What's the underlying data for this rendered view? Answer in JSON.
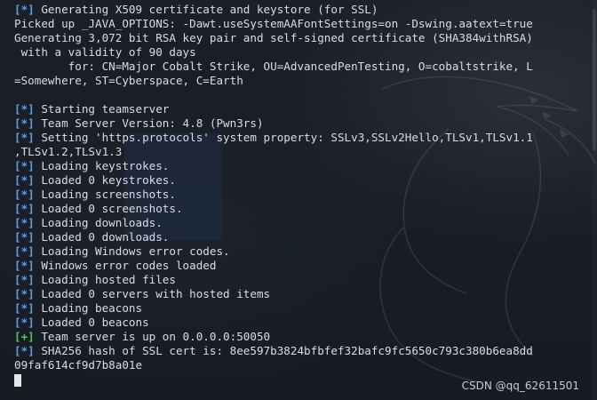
{
  "terminal": {
    "lines": [
      {
        "tag": "[*]",
        "tag_type": "info",
        "text": " Generating X509 certificate and keystore (for SSL)"
      },
      {
        "tag": "",
        "tag_type": "",
        "text": "Picked up _JAVA_OPTIONS: -Dawt.useSystemAAFontSettings=on -Dswing.aatext=true"
      },
      {
        "tag": "",
        "tag_type": "",
        "text": "Generating 3,072 bit RSA key pair and self-signed certificate (SHA384withRSA)"
      },
      {
        "tag": "",
        "tag_type": "",
        "text": " with a validity of 90 days"
      },
      {
        "tag": "",
        "tag_type": "",
        "text": "        for: CN=Major Cobalt Strike, OU=AdvancedPenTesting, O=cobaltstrike, L"
      },
      {
        "tag": "",
        "tag_type": "",
        "text": "=Somewhere, ST=Cyberspace, C=Earth"
      },
      {
        "tag": "",
        "tag_type": "",
        "text": ""
      },
      {
        "tag": "[*]",
        "tag_type": "info",
        "text": " Starting teamserver"
      },
      {
        "tag": "[*]",
        "tag_type": "info",
        "text": " Team Server Version: 4.8 (Pwn3rs)"
      },
      {
        "tag": "[*]",
        "tag_type": "info",
        "text": " Setting 'https.protocols' system property: SSLv3,SSLv2Hello,TLSv1,TLSv1.1"
      },
      {
        "tag": "",
        "tag_type": "",
        "text": ",TLSv1.2,TLSv1.3"
      },
      {
        "tag": "[*]",
        "tag_type": "info",
        "text": " Loading keystrokes."
      },
      {
        "tag": "[*]",
        "tag_type": "info",
        "text": " Loaded 0 keystrokes."
      },
      {
        "tag": "[*]",
        "tag_type": "info",
        "text": " Loading screenshots."
      },
      {
        "tag": "[*]",
        "tag_type": "info",
        "text": " Loaded 0 screenshots."
      },
      {
        "tag": "[*]",
        "tag_type": "info",
        "text": " Loading downloads."
      },
      {
        "tag": "[*]",
        "tag_type": "info",
        "text": " Loaded 0 downloads."
      },
      {
        "tag": "[*]",
        "tag_type": "info",
        "text": " Loading Windows error codes."
      },
      {
        "tag": "[*]",
        "tag_type": "info",
        "text": " Windows error codes loaded"
      },
      {
        "tag": "[*]",
        "tag_type": "info",
        "text": " Loading hosted files"
      },
      {
        "tag": "[*]",
        "tag_type": "info",
        "text": " Loaded 0 servers with hosted items"
      },
      {
        "tag": "[*]",
        "tag_type": "info",
        "text": " Loading beacons"
      },
      {
        "tag": "[*]",
        "tag_type": "info",
        "text": " Loaded 0 beacons"
      },
      {
        "tag": "[+]",
        "tag_type": "ok",
        "text": " Team server is up on 0.0.0.0:50050"
      },
      {
        "tag": "[*]",
        "tag_type": "info",
        "text": " SHA256 hash of SSL cert is: 8ee597b3824bfbfef32bafc9fc5650c793c380b6ea8dd"
      },
      {
        "tag": "",
        "tag_type": "",
        "text": "09faf614cf9d7b8a01e"
      }
    ],
    "prompt_cursor": true
  },
  "watermark": "CSDN @qq_62611501",
  "colors": {
    "background": "#171b22",
    "text": "#d8dde6",
    "info_tag": "#4aa3ff",
    "ok_tag": "#40d04a",
    "cursor": "#e6e6e6"
  },
  "icons": {
    "background_art": "kali-dragon-watermark"
  }
}
